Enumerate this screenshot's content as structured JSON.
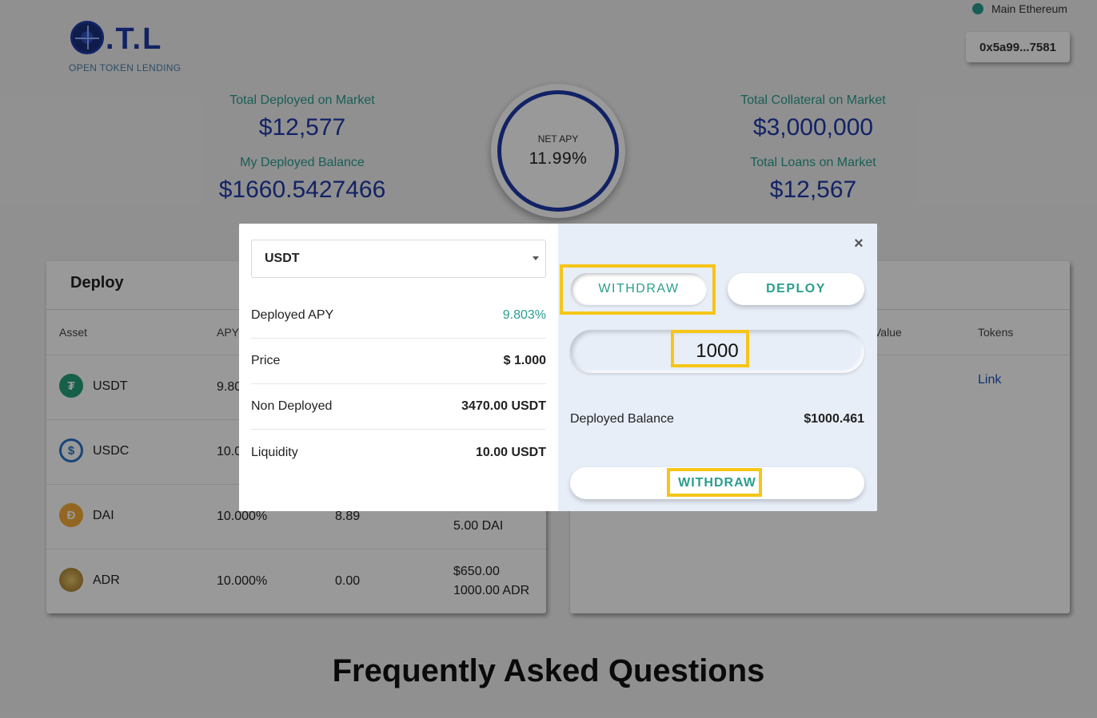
{
  "header": {
    "logo_text": ".T.L",
    "logo_subtitle": "OPEN TOKEN LENDING",
    "network_label": "Main Ethereum",
    "wallet_address": "0x5a99...7581"
  },
  "stats": {
    "total_deployed_label": "Total Deployed on Market",
    "total_deployed_value": "$12,577",
    "my_deployed_label": "My Deployed Balance",
    "my_deployed_value": "$1660.5427466",
    "net_apy_label": "NET APY",
    "net_apy_value": "11.99%",
    "total_collateral_label": "Total Collateral on Market",
    "total_collateral_value": "$3,000,000",
    "total_loans_label": "Total Loans on Market",
    "total_loans_value": "$12,567"
  },
  "deploy_card": {
    "title": "Deploy",
    "columns": [
      "Asset",
      "APY"
    ],
    "rows": [
      {
        "asset": "USDT",
        "apy": "9.80",
        "icon": "tether-icon",
        "color": "#26a17b"
      },
      {
        "asset": "USDC",
        "apy": "10.0",
        "icon": "usdc-icon",
        "color": "#2775ca"
      },
      {
        "asset": "DAI",
        "apy": "10.000%",
        "col3": "8.89",
        "col4b": "5.00 DAI",
        "icon": "dai-icon",
        "color": "#f5ac37"
      },
      {
        "asset": "ADR",
        "apy": "10.000%",
        "col3": "0.00",
        "col4a": "$650.00",
        "col4b": "1000.00 ADR",
        "icon": "adr-icon",
        "color": "#c9a24a"
      }
    ]
  },
  "right_card": {
    "col_value": "Value",
    "col_tokens": "Tokens",
    "link_label": "Link"
  },
  "faq_title": "Frequently Asked Questions",
  "modal": {
    "selected_asset": "USDT",
    "info": [
      {
        "label": "Deployed APY",
        "value": "9.803%"
      },
      {
        "label": "Price",
        "value": "$ 1.000"
      },
      {
        "label": "Non Deployed",
        "value": "3470.00 USDT"
      },
      {
        "label": "Liquidity",
        "value": "10.00 USDT"
      }
    ],
    "close_label": "×",
    "tab_withdraw": "WITHDRAW",
    "tab_deploy": "DEPLOY",
    "amount_value": "1000",
    "deployed_balance_label": "Deployed Balance",
    "deployed_balance_value": "$1000.461",
    "submit_label": "WITHDRAW"
  },
  "colors": {
    "accent_teal": "#2a9d8f",
    "brand_blue": "#1e3aa8",
    "highlight_yellow": "#f5c518"
  }
}
